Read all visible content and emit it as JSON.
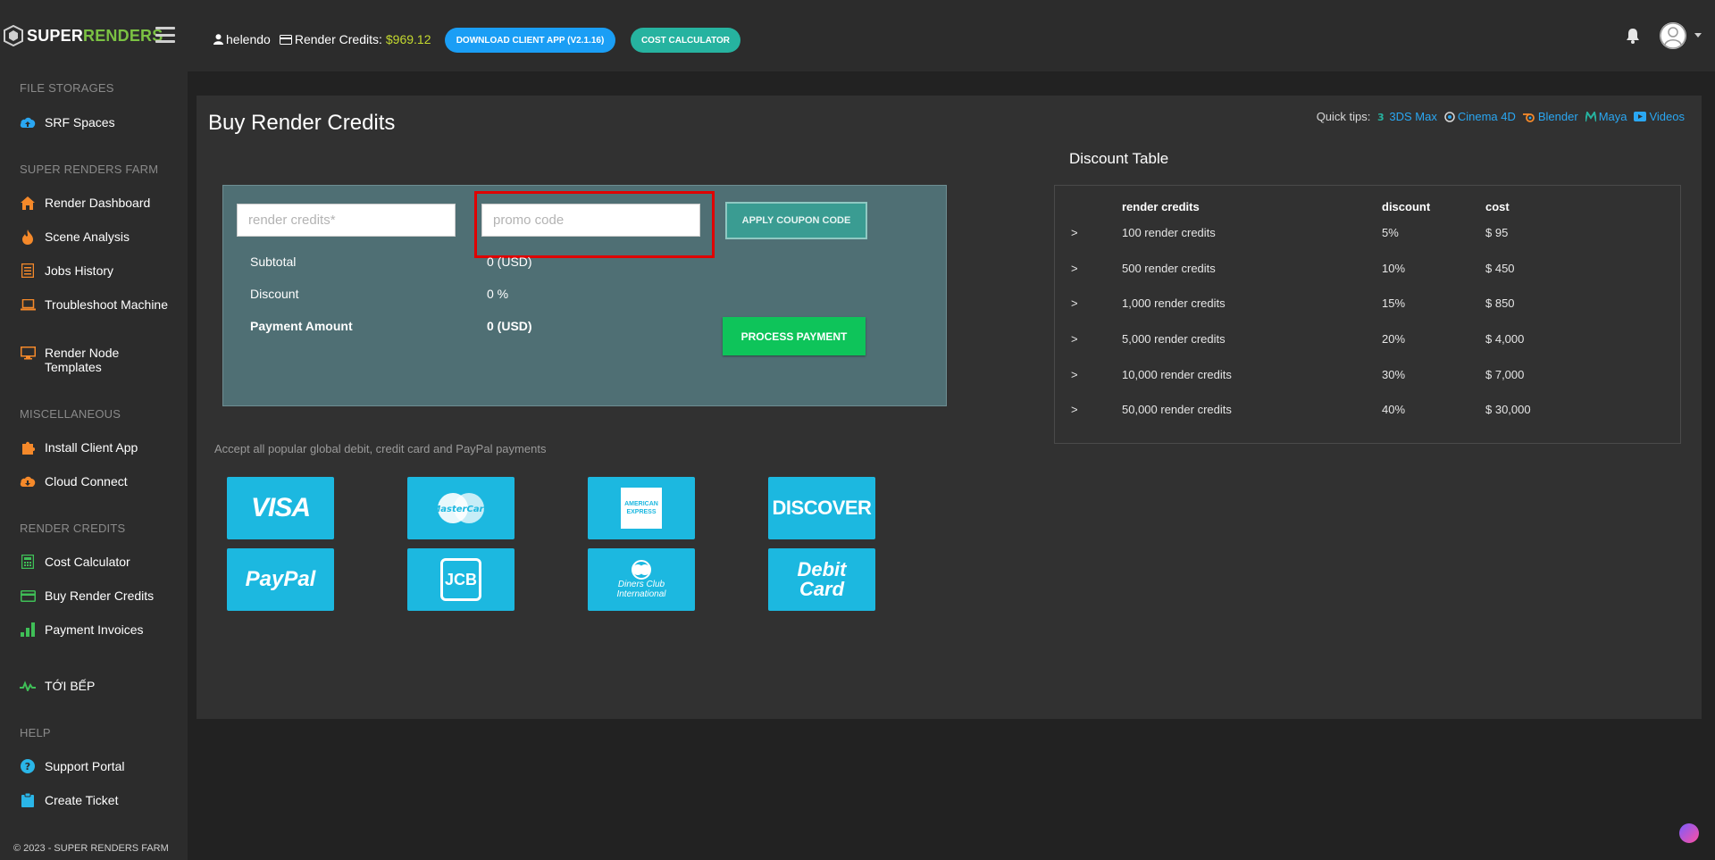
{
  "header": {
    "logo_white": "SUPER",
    "logo_green": "RENDERS",
    "username": "helendo",
    "credits_label": "Render Credits:",
    "credits_value": "$969.12",
    "download_btn": "DOWNLOAD CLIENT APP (V2.1.16)",
    "calc_btn": "COST CALCULATOR"
  },
  "sidebar": {
    "sections": [
      {
        "heading": "FILE STORAGES",
        "items": [
          {
            "label": "SRF Spaces",
            "icon": "cloud-upload-icon",
            "color": "#2aa7f2"
          }
        ]
      },
      {
        "heading": "SUPER RENDERS FARM",
        "items": [
          {
            "label": "Render Dashboard",
            "icon": "home-icon",
            "color": "#f5892a"
          },
          {
            "label": "Scene Analysis",
            "icon": "fire-icon",
            "color": "#f5892a"
          },
          {
            "label": "Jobs History",
            "icon": "list-icon",
            "color": "#f5892a"
          },
          {
            "label": "Troubleshoot Machine",
            "icon": "laptop-icon",
            "color": "#f5892a"
          },
          {
            "label": "Render Node Templates",
            "icon": "monitor-icon",
            "color": "#f5892a"
          }
        ]
      },
      {
        "heading": "MISCELLANEOUS",
        "items": [
          {
            "label": "Install Client App",
            "icon": "puzzle-icon",
            "color": "#f5892a"
          },
          {
            "label": "Cloud Connect",
            "icon": "cloud-download-icon",
            "color": "#f5892a"
          }
        ]
      },
      {
        "heading": "RENDER CREDITS",
        "items": [
          {
            "label": "Cost Calculator",
            "icon": "calculator-icon",
            "color": "#3fbf57"
          },
          {
            "label": "Buy Render Credits",
            "icon": "credit-card-icon",
            "color": "#3fbf57"
          },
          {
            "label": "Payment Invoices",
            "icon": "bar-chart-icon",
            "color": "#3fbf57"
          }
        ]
      },
      {
        "heading": "",
        "items": [
          {
            "label": "TỚI BẾP",
            "icon": "pulse-icon",
            "color": "#3fbf57"
          }
        ]
      },
      {
        "heading": "HELP",
        "items": [
          {
            "label": "Support Portal",
            "icon": "question-circle-icon",
            "color": "#2ab6e8"
          },
          {
            "label": "Create Ticket",
            "icon": "clipboard-icon",
            "color": "#2ab6e8"
          }
        ]
      }
    ],
    "footer": "© 2023 - SUPER RENDERS FARM"
  },
  "main": {
    "title": "Buy Render Credits",
    "quick_tips_label": "Quick tips:",
    "quick_tips": [
      {
        "label": "3DS Max",
        "icon": "3dsmax-icon"
      },
      {
        "label": "Cinema 4D",
        "icon": "cinema4d-icon"
      },
      {
        "label": "Blender",
        "icon": "blender-icon"
      },
      {
        "label": "Maya",
        "icon": "maya-icon"
      },
      {
        "label": "Videos",
        "icon": "video-icon"
      }
    ],
    "form": {
      "credits_placeholder": "render credits*",
      "promo_placeholder": "promo code",
      "coupon_btn": "APPLY COUPON CODE",
      "subtotal_label": "Subtotal",
      "subtotal_value": "0 (USD)",
      "discount_label": "Discount",
      "discount_value": "0 %",
      "payment_label": "Payment Amount",
      "payment_value": "0 (USD)",
      "pay_btn": "PROCESS PAYMENT"
    },
    "accept_text": "Accept all popular global debit, credit card and PayPal payments",
    "cards": [
      {
        "name": "visa",
        "label": "VISA"
      },
      {
        "name": "mastercard",
        "label": "MasterCard"
      },
      {
        "name": "amex",
        "label": "AMERICAN EXPRESS"
      },
      {
        "name": "discover",
        "label": "DISCOVER"
      },
      {
        "name": "paypal",
        "label": "PayPal"
      },
      {
        "name": "jcb",
        "label": "JCB"
      },
      {
        "name": "diners",
        "label": "Diners Club International"
      },
      {
        "name": "debit",
        "label": "Debit Card"
      }
    ],
    "discount_table": {
      "title": "Discount Table",
      "headers": [
        "render credits",
        "discount",
        "cost"
      ],
      "rows": [
        {
          "arrow": ">",
          "credits": "100 render credits",
          "discount": "5%",
          "cost": "$ 95"
        },
        {
          "arrow": ">",
          "credits": "500 render credits",
          "discount": "10%",
          "cost": "$ 450"
        },
        {
          "arrow": ">",
          "credits": "1,000 render credits",
          "discount": "15%",
          "cost": "$ 850"
        },
        {
          "arrow": ">",
          "credits": "5,000 render credits",
          "discount": "20%",
          "cost": "$ 4,000"
        },
        {
          "arrow": ">",
          "credits": "10,000 render credits",
          "discount": "30%",
          "cost": "$ 7,000"
        },
        {
          "arrow": ">",
          "credits": "50,000 render credits",
          "discount": "40%",
          "cost": "$ 30,000"
        }
      ]
    }
  }
}
